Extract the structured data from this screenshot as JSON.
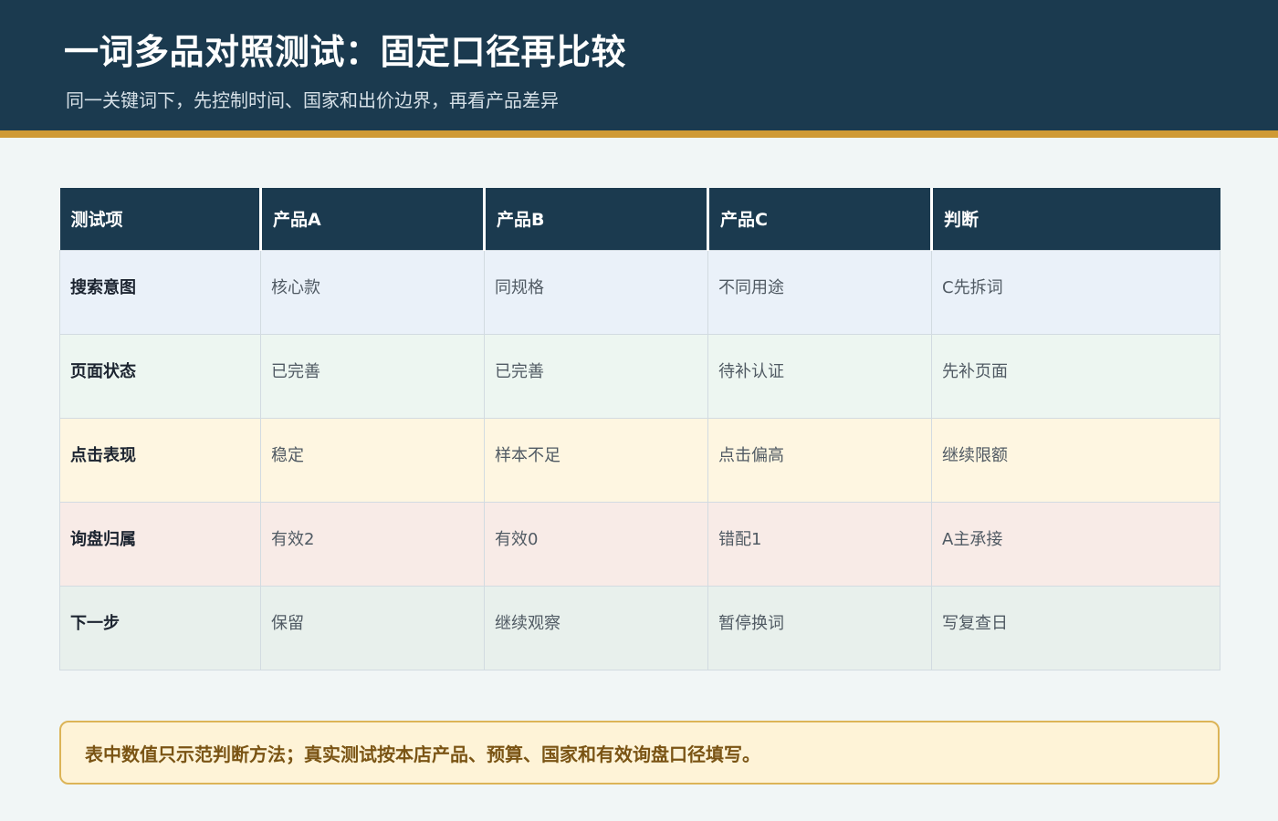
{
  "header": {
    "title": "一词多品对照测试：固定口径再比较",
    "subtitle": "同一关键词下，先控制时间、国家和出价边界，再看产品差异"
  },
  "table": {
    "columns": [
      "测试项",
      "产品A",
      "产品B",
      "产品C",
      "判断"
    ],
    "rows": [
      [
        "搜索意图",
        "核心款",
        "同规格",
        "不同用途",
        "C先拆词"
      ],
      [
        "页面状态",
        "已完善",
        "已完善",
        "待补认证",
        "先补页面"
      ],
      [
        "点击表现",
        "稳定",
        "样本不足",
        "点击偏高",
        "继续限额"
      ],
      [
        "询盘归属",
        "有效2",
        "有效0",
        "错配1",
        "A主承接"
      ],
      [
        "下一步",
        "保留",
        "继续观察",
        "暂停换词",
        "写复查日"
      ]
    ]
  },
  "note": {
    "text": "表中数值只示范判断方法；真实测试按本店产品、预算、国家和有效询盘口径填写。"
  }
}
